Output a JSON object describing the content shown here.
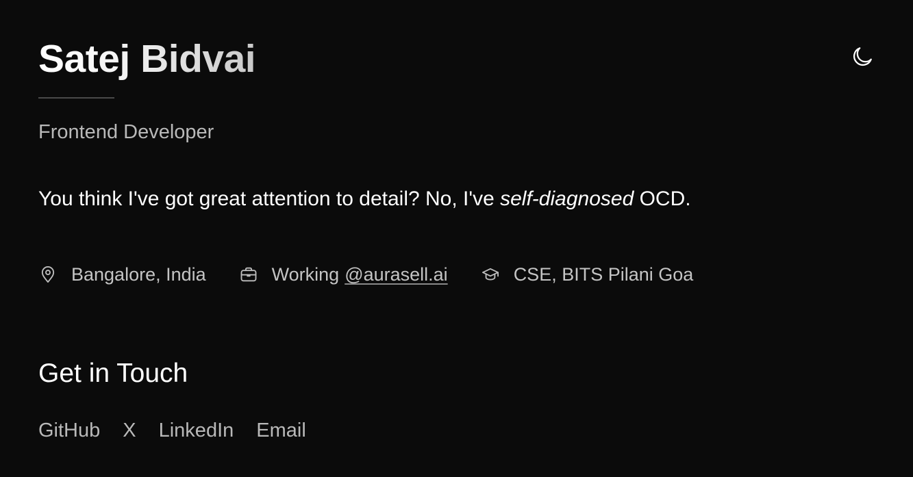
{
  "header": {
    "name": "Satej Bidvai",
    "theme_toggle_icon": "moon-icon"
  },
  "profile": {
    "role": "Frontend Developer",
    "bio": {
      "before": "You think I've got great attention to detail? No, I've ",
      "emphasis": "self-diagnosed",
      "after": " OCD."
    }
  },
  "meta": {
    "location": {
      "icon": "map-pin-icon",
      "text": "Bangalore, India"
    },
    "work": {
      "icon": "briefcase-icon",
      "prefix": "Working",
      "link_text": "@aurasell.ai"
    },
    "education": {
      "icon": "graduation-cap-icon",
      "text": "CSE, BITS Pilani Goa"
    }
  },
  "contact": {
    "heading": "Get in Touch",
    "links": [
      "GitHub",
      "X",
      "LinkedIn",
      "Email"
    ]
  },
  "colors": {
    "background": "#0b0b0b",
    "primary_text": "#ffffff",
    "secondary_text": "#b9b9b9",
    "divider": "#4a4a4a"
  }
}
